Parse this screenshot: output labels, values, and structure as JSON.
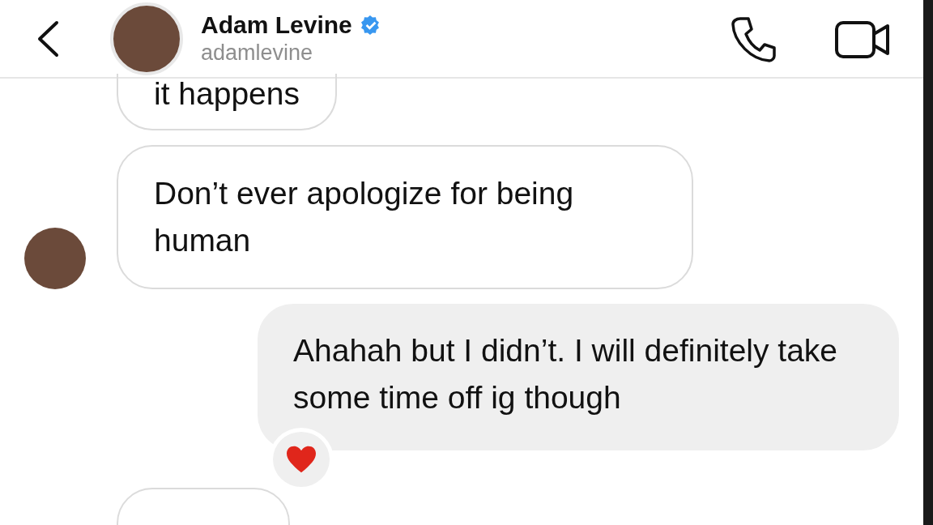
{
  "header": {
    "name": "Adam Levine",
    "verified": true,
    "username": "adamlevine"
  },
  "messages": [
    {
      "kind": "received",
      "text": "it happens",
      "avatar": false,
      "reacted": false
    },
    {
      "kind": "received",
      "text": "Don’t ever apologize for being human",
      "avatar": true,
      "reacted": false
    },
    {
      "kind": "sent",
      "text": "Ahahah but I didn’t. I will definitely take some time off ig though",
      "avatar": false,
      "reacted": true
    },
    {
      "kind": "received",
      "avatar": false,
      "reacted": false
    }
  ]
}
